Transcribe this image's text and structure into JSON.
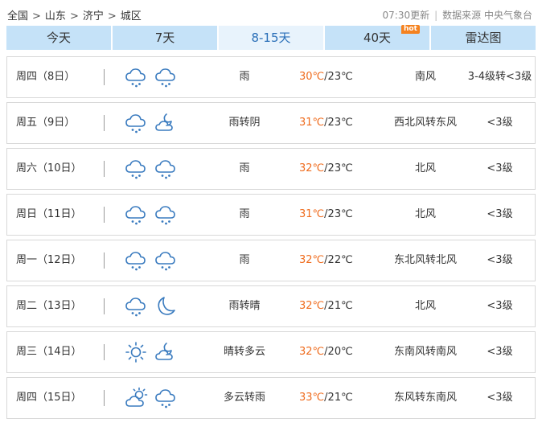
{
  "breadcrumb": [
    "全国",
    "山东",
    "济宁",
    "城区"
  ],
  "breadcrumb_sep": ">",
  "update_time": "07:30更新",
  "source_label": "数据来源 中央气象台",
  "tabs": [
    {
      "label": "今天"
    },
    {
      "label": "7天"
    },
    {
      "label": "8-15天"
    },
    {
      "label": "40天",
      "badge": "hot"
    },
    {
      "label": "雷达图"
    }
  ],
  "active_tab": 2,
  "temp_separator": "/",
  "days": [
    {
      "date": "周四（8日）",
      "icons": [
        "rain-cloud-icon",
        "rain-cloud-icon"
      ],
      "weather": "雨",
      "high": "30℃",
      "low": "23℃",
      "wind": "南风",
      "level": "3-4级转<3级"
    },
    {
      "date": "周五（9日）",
      "icons": [
        "rain-cloud-icon",
        "cloudy-night-icon"
      ],
      "weather": "雨转阴",
      "high": "31℃",
      "low": "23℃",
      "wind": "西北风转东风",
      "level": "<3级"
    },
    {
      "date": "周六（10日）",
      "icons": [
        "rain-cloud-icon",
        "rain-cloud-icon"
      ],
      "weather": "雨",
      "high": "32℃",
      "low": "23℃",
      "wind": "北风",
      "level": "<3级"
    },
    {
      "date": "周日（11日）",
      "icons": [
        "rain-cloud-icon",
        "rain-cloud-icon"
      ],
      "weather": "雨",
      "high": "31℃",
      "low": "23℃",
      "wind": "北风",
      "level": "<3级"
    },
    {
      "date": "周一（12日）",
      "icons": [
        "rain-cloud-icon",
        "rain-cloud-icon"
      ],
      "weather": "雨",
      "high": "32℃",
      "low": "22℃",
      "wind": "东北风转北风",
      "level": "<3级"
    },
    {
      "date": "周二（13日）",
      "icons": [
        "rain-cloud-icon",
        "moon-icon"
      ],
      "weather": "雨转晴",
      "high": "32℃",
      "low": "21℃",
      "wind": "北风",
      "level": "<3级"
    },
    {
      "date": "周三（14日）",
      "icons": [
        "sun-icon",
        "cloudy-night-icon"
      ],
      "weather": "晴转多云",
      "high": "32℃",
      "low": "20℃",
      "wind": "东南风转南风",
      "level": "<3级"
    },
    {
      "date": "周四（15日）",
      "icons": [
        "partly-cloudy-day-icon",
        "rain-cloud-icon"
      ],
      "weather": "多云转雨",
      "high": "33℃",
      "low": "21℃",
      "wind": "东风转东南风",
      "level": "<3级"
    }
  ],
  "colors": {
    "accent": "#3a7bbf",
    "high_temp": "#ef6c1e",
    "tab_bg": "#c5e2f8",
    "tab_active_bg": "#e8f3fc",
    "hot_badge": "#f5821f"
  }
}
